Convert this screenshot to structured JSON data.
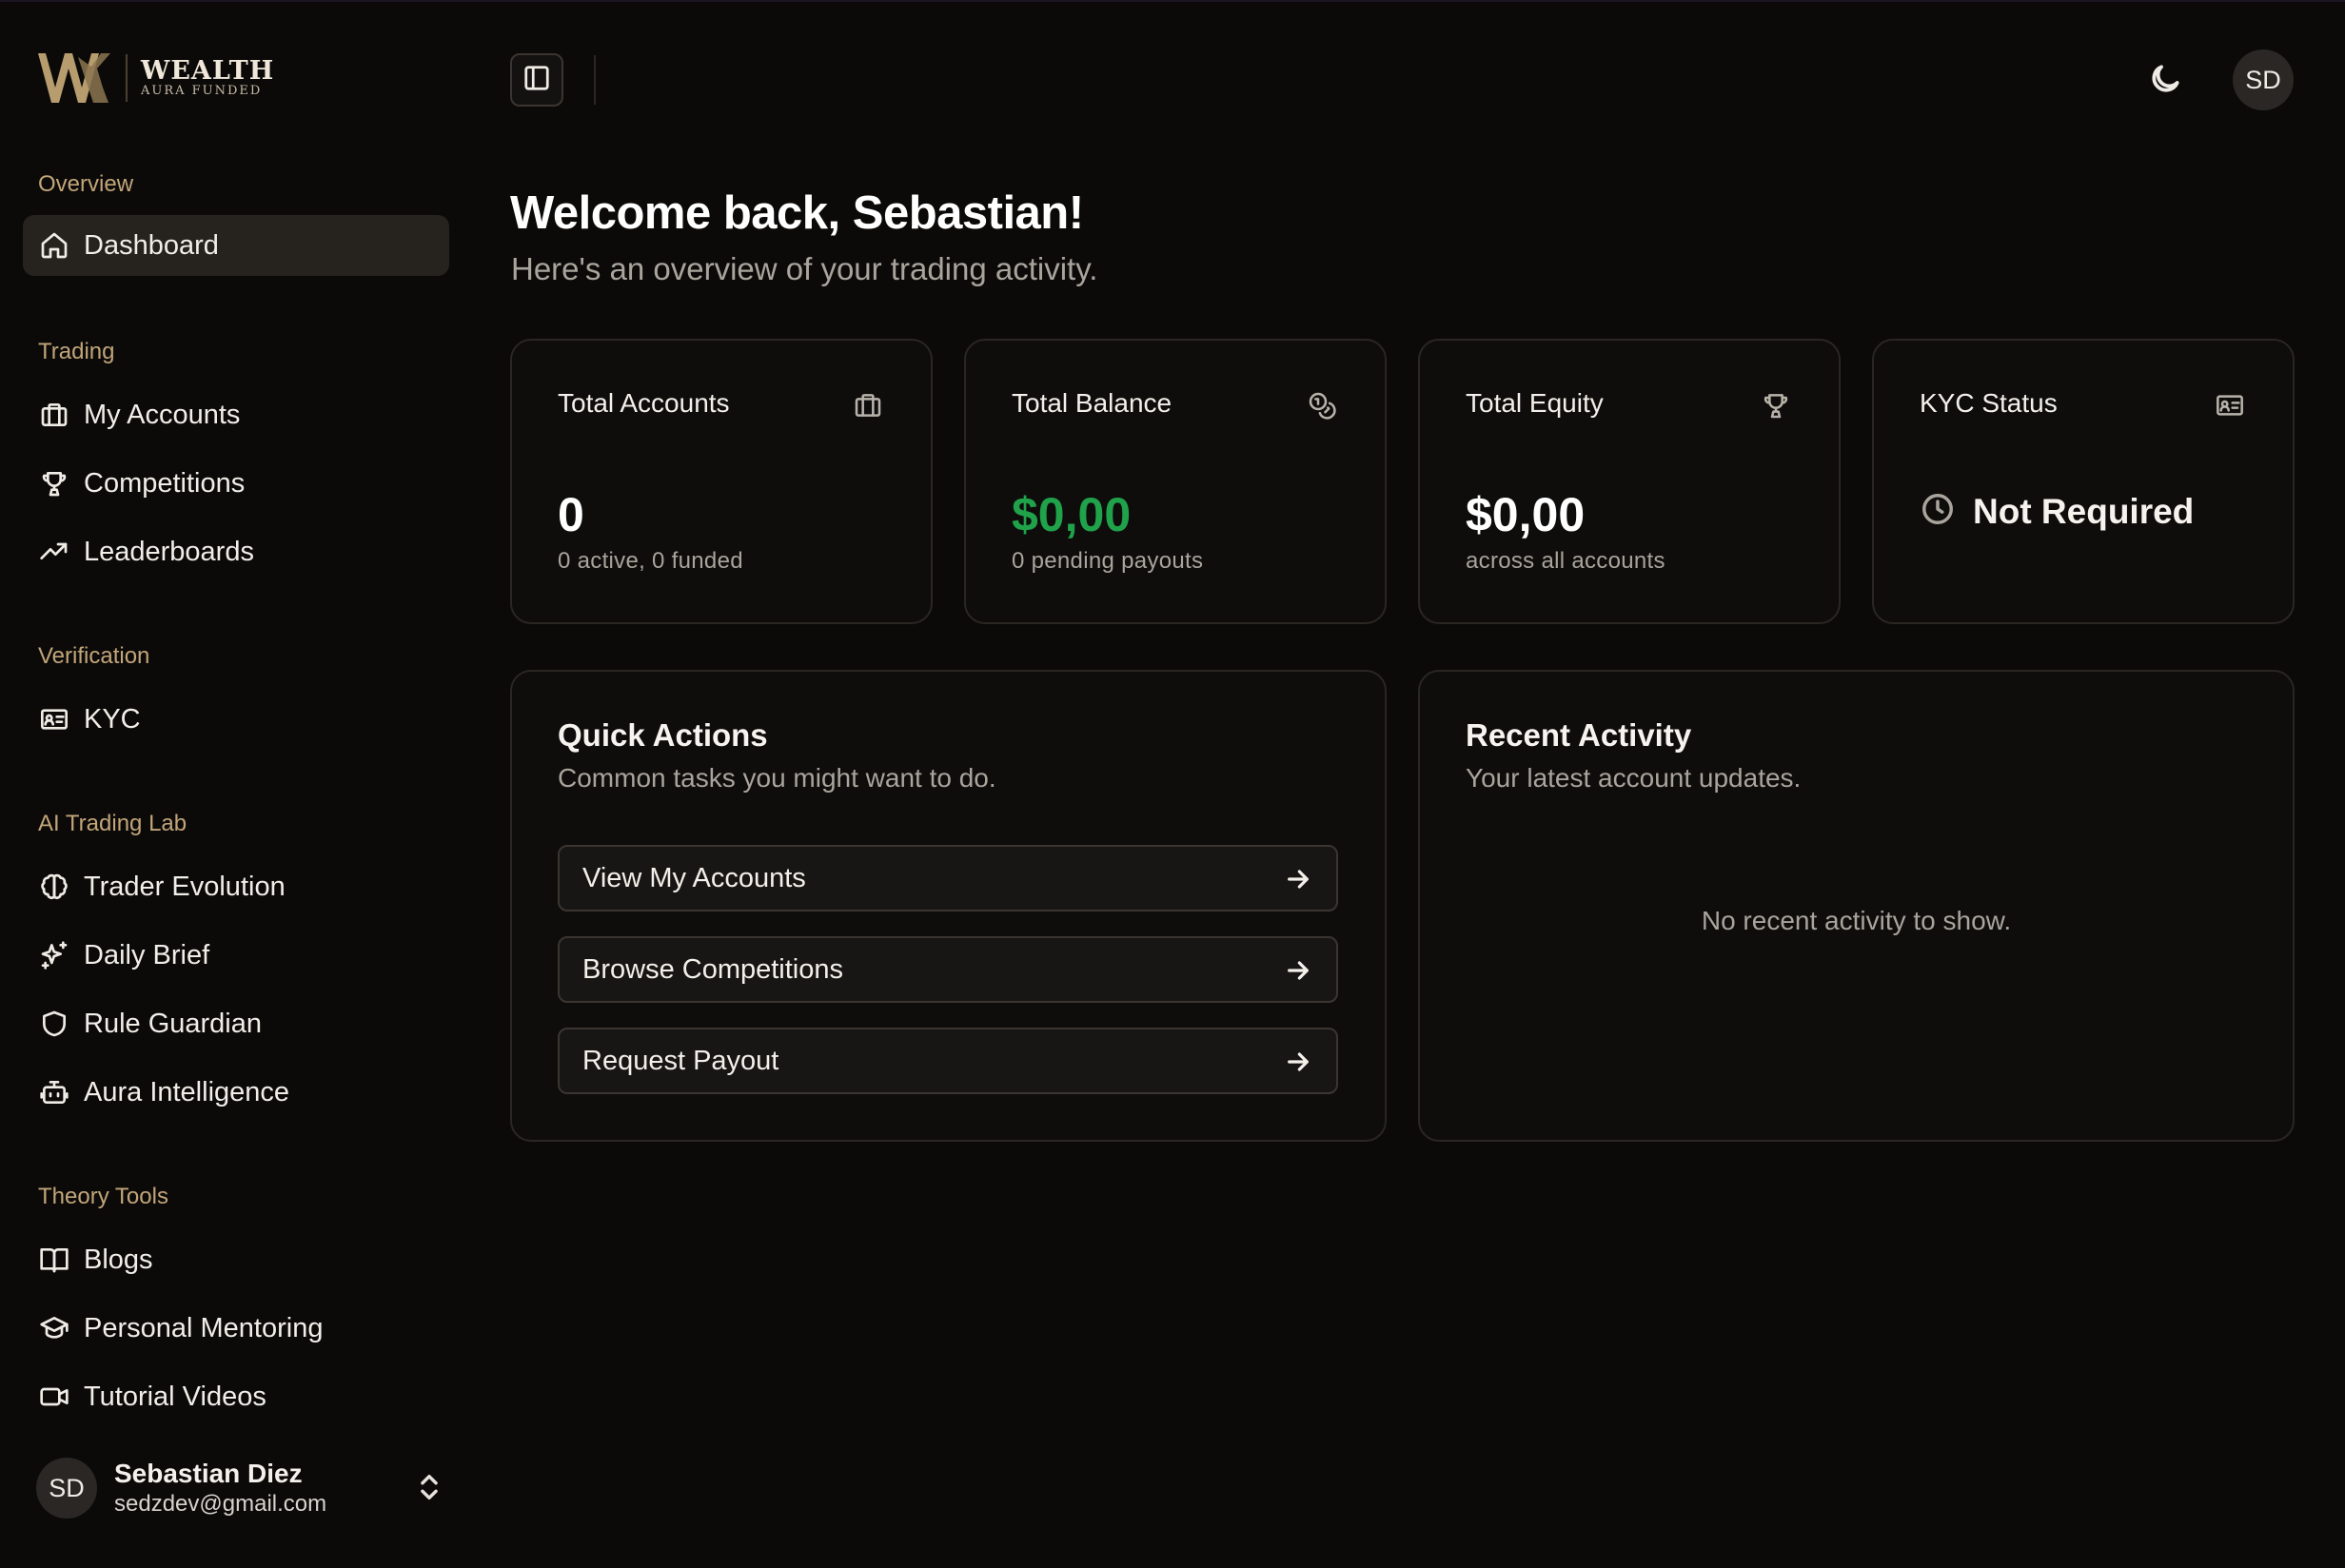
{
  "brand": {
    "name": "WEALTH",
    "tagline": "AURA FUNDED",
    "accent": "#c2a579"
  },
  "sidebar": {
    "sections": [
      {
        "label": "Overview"
      },
      {
        "label": "Trading"
      },
      {
        "label": "Verification"
      },
      {
        "label": "AI Trading Lab"
      },
      {
        "label": "Theory Tools"
      }
    ],
    "items": [
      {
        "label": "Dashboard",
        "icon": "home-icon",
        "active": true
      },
      {
        "label": "My Accounts",
        "icon": "briefcase-icon"
      },
      {
        "label": "Competitions",
        "icon": "trophy-icon"
      },
      {
        "label": "Leaderboards",
        "icon": "trending-up-icon"
      },
      {
        "label": "KYC",
        "icon": "id-card-icon"
      },
      {
        "label": "Trader Evolution",
        "icon": "brain-icon"
      },
      {
        "label": "Daily Brief",
        "icon": "sparkles-icon"
      },
      {
        "label": "Rule Guardian",
        "icon": "shield-icon"
      },
      {
        "label": "Aura Intelligence",
        "icon": "bot-icon"
      },
      {
        "label": "Blogs",
        "icon": "book-icon"
      },
      {
        "label": "Personal Mentoring",
        "icon": "graduation-cap-icon"
      },
      {
        "label": "Tutorial Videos",
        "icon": "video-icon"
      }
    ],
    "user": {
      "initials": "SD",
      "name": "Sebastian Diez",
      "email": "sedzdev@gmail.com"
    }
  },
  "topbar": {
    "avatar_initials": "SD",
    "theme_icon": "moon-icon",
    "toggle_icon": "panel-left-icon"
  },
  "main": {
    "welcome_title": "Welcome back, Sebastian!",
    "welcome_subtitle": "Here's an overview of your trading activity.",
    "stats": [
      {
        "title": "Total Accounts",
        "value": "0",
        "sub": "0 active, 0 funded",
        "icon": "briefcase-icon"
      },
      {
        "title": "Total Balance",
        "value": "$0,00",
        "sub": "0 pending payouts",
        "icon": "coins-icon",
        "value_color": "#1fa24a"
      },
      {
        "title": "Total Equity",
        "value": "$0,00",
        "sub": "across all accounts",
        "icon": "trophy-icon"
      },
      {
        "title": "KYC Status",
        "value": "Not Required",
        "icon": "id-card-icon",
        "status_icon": "clock-icon"
      }
    ],
    "quick_actions": {
      "title": "Quick Actions",
      "subtitle": "Common tasks you might want to do.",
      "buttons": [
        {
          "label": "View My Accounts",
          "icon": "arrow-right-icon"
        },
        {
          "label": "Browse Competitions",
          "icon": "arrow-right-icon"
        },
        {
          "label": "Request Payout",
          "icon": "arrow-right-icon"
        }
      ]
    },
    "recent_activity": {
      "title": "Recent Activity",
      "subtitle": "Your latest account updates.",
      "empty_message": "No recent activity to show."
    }
  }
}
